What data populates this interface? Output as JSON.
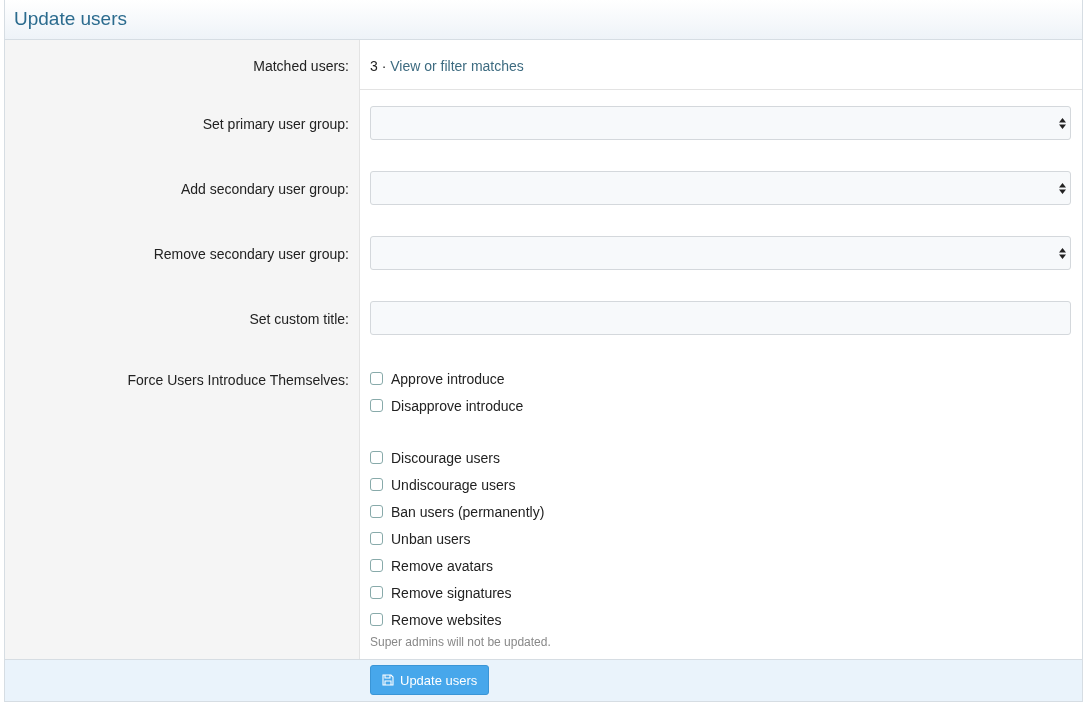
{
  "title": "Update users",
  "matched": {
    "label": "Matched users:",
    "count": "3 ·",
    "link": "View or filter matches"
  },
  "fields": [
    {
      "label": "Set primary user group:",
      "kind": "select"
    },
    {
      "label": "Add secondary user group:",
      "kind": "select"
    },
    {
      "label": "Remove secondary user group:",
      "kind": "select"
    },
    {
      "label": "Set custom title:",
      "kind": "text"
    }
  ],
  "options": {
    "label": "Force Users Introduce Themselves:",
    "groups": [
      [
        {
          "label": "Approve introduce",
          "checked": false
        },
        {
          "label": "Disapprove introduce",
          "checked": false
        }
      ],
      [
        {
          "label": "Discourage users",
          "checked": false
        },
        {
          "label": "Undiscourage users",
          "checked": false
        },
        {
          "label": "Ban users (permanently)",
          "checked": false
        },
        {
          "label": "Unban users",
          "checked": false
        },
        {
          "label": "Remove avatars",
          "checked": false
        },
        {
          "label": "Remove signatures",
          "checked": false
        },
        {
          "label": "Remove websites",
          "checked": false
        }
      ]
    ],
    "note": "Super admins will not be updated."
  },
  "button": "Update users"
}
